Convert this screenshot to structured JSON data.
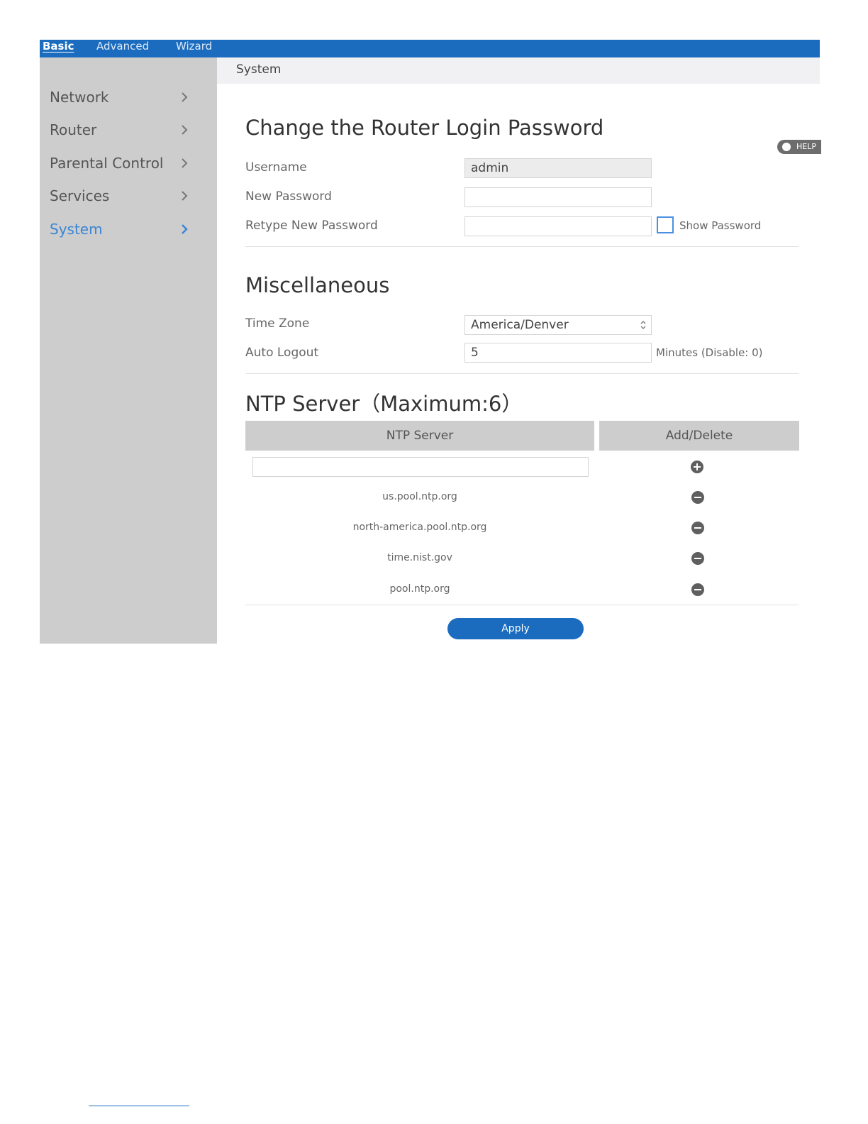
{
  "topbar": {
    "tabs": [
      {
        "label": "Basic"
      },
      {
        "label": "Advanced"
      },
      {
        "label": "Wizard"
      }
    ]
  },
  "sidebar": {
    "items": [
      {
        "label": "Network"
      },
      {
        "label": "Router"
      },
      {
        "label": "Parental Control"
      },
      {
        "label": "Services"
      },
      {
        "label": "System"
      }
    ]
  },
  "breadcrumb": "System",
  "help_label": "HELP",
  "password_section": {
    "title": "Change the Router Login Password",
    "username_label": "Username",
    "username_value": "admin",
    "new_password_label": "New Password",
    "new_password_value": "",
    "retype_label": "Retype New Password",
    "retype_value": "",
    "show_password_label": "Show Password",
    "show_password_checked": false
  },
  "misc_section": {
    "title": "Miscellaneous",
    "timezone_label": "Time Zone",
    "timezone_value": "America/Denver",
    "autologout_label": "Auto Logout",
    "autologout_value": "5",
    "autologout_hint": "Minutes (Disable: 0)"
  },
  "ntp_section": {
    "title": "NTP Server（Maximum:6）",
    "col_server": "NTP Server",
    "col_action": "Add/Delete",
    "new_server_value": "",
    "servers": [
      {
        "host": "us.pool.ntp.org"
      },
      {
        "host": "north-america.pool.ntp.org"
      },
      {
        "host": "time.nist.gov"
      },
      {
        "host": "pool.ntp.org"
      }
    ]
  },
  "apply_label": "Apply",
  "colors": {
    "accent": "#1b6cbf",
    "active_nav": "#3b86d6",
    "sidebar_bg": "#cdcdcd"
  }
}
